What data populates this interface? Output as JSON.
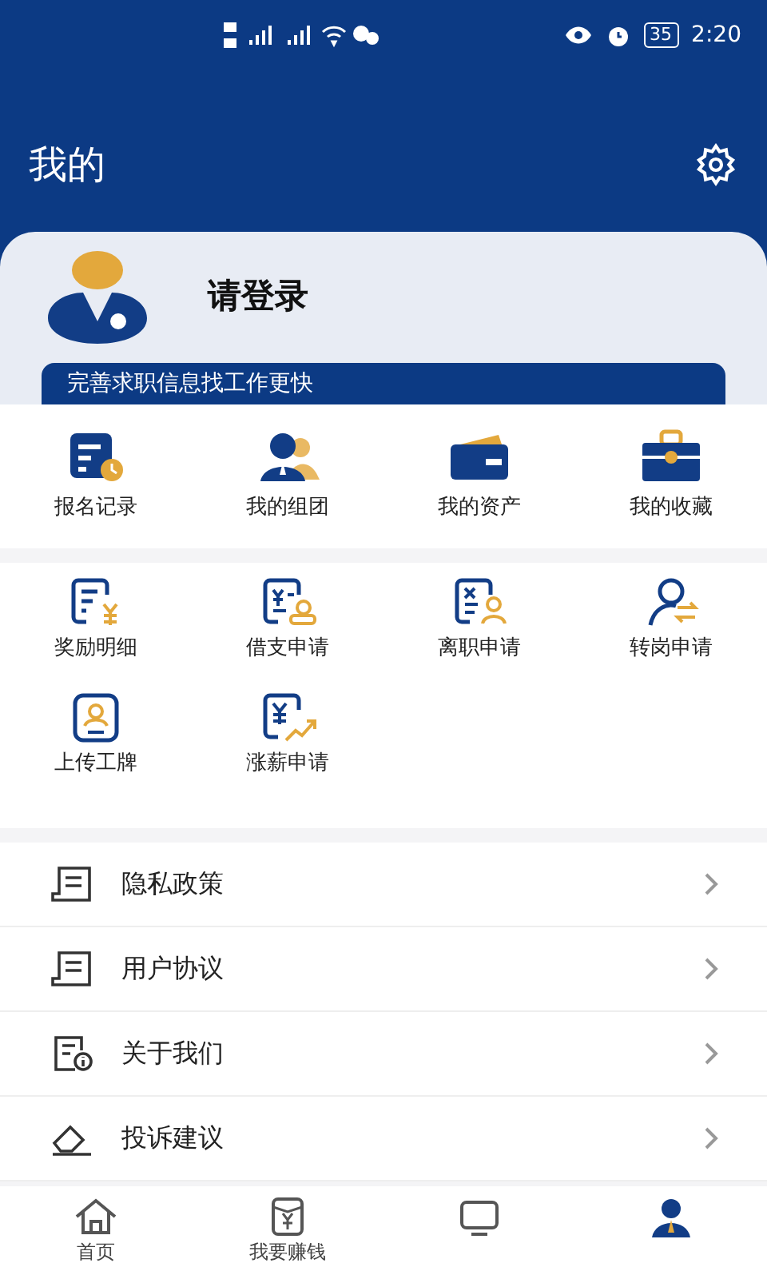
{
  "status_bar": {
    "battery": "35",
    "time": "2:20"
  },
  "header": {
    "title": "我的"
  },
  "profile": {
    "name": "请登录",
    "banner": "完善求职信息找工作更快"
  },
  "shortcuts": [
    {
      "label": "报名记录",
      "kind": "record"
    },
    {
      "label": "我的组团",
      "kind": "team"
    },
    {
      "label": "我的资产",
      "kind": "wallet"
    },
    {
      "label": "我的收藏",
      "kind": "briefcase"
    }
  ],
  "services": [
    {
      "label": "奖励明细",
      "kind": "reward"
    },
    {
      "label": "借支申请",
      "kind": "loan"
    },
    {
      "label": "离职申请",
      "kind": "resign"
    },
    {
      "label": "转岗申请",
      "kind": "transfer"
    },
    {
      "label": "上传工牌",
      "kind": "badge"
    },
    {
      "label": "涨薪申请",
      "kind": "raise"
    }
  ],
  "menu": [
    {
      "label": "隐私政策",
      "kind": "doc"
    },
    {
      "label": "用户协议",
      "kind": "doc"
    },
    {
      "label": "关于我们",
      "kind": "info"
    },
    {
      "label": "投诉建议",
      "kind": "feedback"
    }
  ],
  "tab_bar": [
    {
      "label": "首页",
      "kind": "home"
    },
    {
      "label": "我要赚钱",
      "kind": "money"
    },
    {
      "kind": "screen"
    },
    {
      "kind": "person"
    }
  ]
}
